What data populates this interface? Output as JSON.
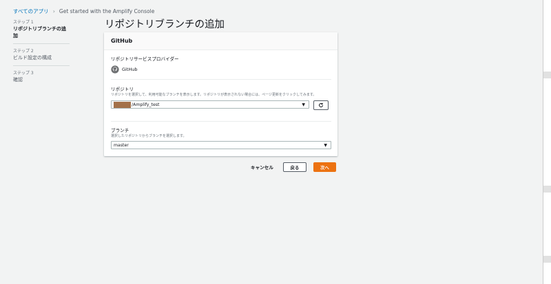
{
  "breadcrumb": {
    "root": "すべてのアプリ",
    "separator": "›",
    "current": "Get started with the Amplify Console"
  },
  "steps": [
    {
      "num": "ステップ 1",
      "title": "リポジトリブランチの追加",
      "active": true
    },
    {
      "num": "ステップ 2",
      "title": "ビルド設定の構成",
      "active": false
    },
    {
      "num": "ステップ 3",
      "title": "確認",
      "active": false
    }
  ],
  "page_title": "リポジトリブランチの追加",
  "panel": {
    "header": "GitHub",
    "provider": {
      "label": "リポジトリサービスプロバイダー",
      "name": "GitHub",
      "icon": "github-icon"
    },
    "repository": {
      "label": "リポジトリ",
      "description": "リポジトリを選択して、利用可能なブランチを表示します。リポジトリが表示されない場合には、ページ更新をクリックしてみます。",
      "value": "/Amplify_test",
      "refresh_icon": "refresh-icon"
    },
    "branch": {
      "label": "ブランチ",
      "description": "選択したリポジトリからブランチを選択します。",
      "value": "master"
    }
  },
  "actions": {
    "cancel": "キャンセル",
    "back": "戻る",
    "next": "次へ"
  },
  "colors": {
    "primary": "#ec7211",
    "link": "#0073bb",
    "background": "#f2f3f3"
  }
}
